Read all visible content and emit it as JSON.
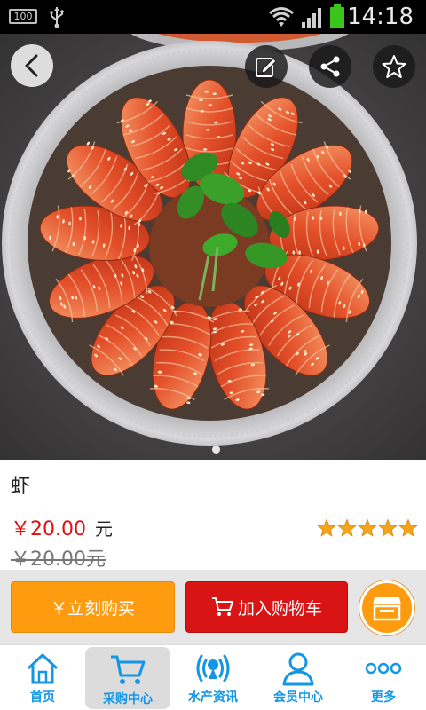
{
  "status_bar": {
    "battery_level": "100",
    "time": "14:18"
  },
  "product": {
    "name": "虾",
    "price": "￥20.00",
    "unit": "元",
    "original_price": "￥20.00元",
    "rating_stars": 5,
    "rating_max": 5
  },
  "actions": {
    "buy_now_label": "￥立刻购买",
    "add_to_cart_label": "加入购物车"
  },
  "nav": {
    "items": [
      {
        "label": "首页",
        "icon": "home-icon"
      },
      {
        "label": "采购中心",
        "icon": "cart-icon"
      },
      {
        "label": "水产资讯",
        "icon": "broadcast-icon"
      },
      {
        "label": "会员中心",
        "icon": "user-icon"
      },
      {
        "label": "更多",
        "icon": "more-dots-icon"
      }
    ],
    "active_index": 1
  },
  "colors": {
    "price": "#e01010",
    "buy_now": "#ff9b0f",
    "add_to_cart": "#d81414",
    "nav_accent": "#1496e6",
    "star": "#f5a319"
  }
}
